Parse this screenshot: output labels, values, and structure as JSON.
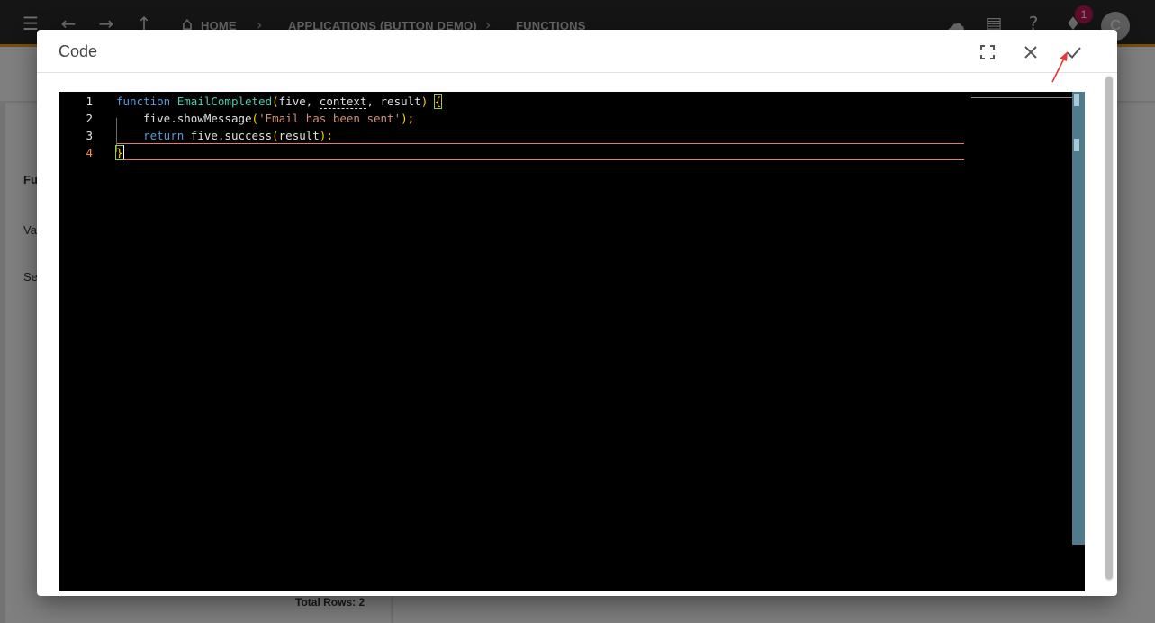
{
  "topbar": {
    "breadcrumbs": [
      "HOME",
      "APPLICATIONS (BUTTON DEMO)",
      "FUNCTIONS"
    ],
    "notification_count": "1",
    "avatar_initial": "C"
  },
  "background": {
    "list_partial_labels": [
      "Fu",
      "Va",
      "Se"
    ],
    "total_rows": "Total Rows: 2"
  },
  "dialog": {
    "title": "Code",
    "buttons": {
      "fullscreen": "fullscreen-icon",
      "close": "close-icon",
      "confirm": "check-icon"
    },
    "annotation_arrow_color": "#e53935"
  },
  "editor": {
    "line_numbers": [
      "1",
      "2",
      "3",
      "4"
    ],
    "active_line": "4",
    "lines": {
      "l1": {
        "kw": "function",
        "name": "EmailCompleted",
        "open": "(",
        "p1": "five, ",
        "p2": "context",
        "p3": ", result",
        "close": ")",
        "brace": "{"
      },
      "l2": {
        "obj": "five.showMessage",
        "open": "(",
        "str": "'Email has been sent'",
        "close": ");"
      },
      "l3": {
        "kw": "return",
        "obj": " five.success",
        "open": "(",
        "arg": "result",
        "close": ");"
      },
      "l4": {
        "brace": "}"
      }
    },
    "colors": {
      "background": "#000000",
      "keyword": "#569cd6",
      "function_name": "#4ec9b0",
      "string": "#ce9178",
      "bracket": "#ffd700"
    }
  }
}
